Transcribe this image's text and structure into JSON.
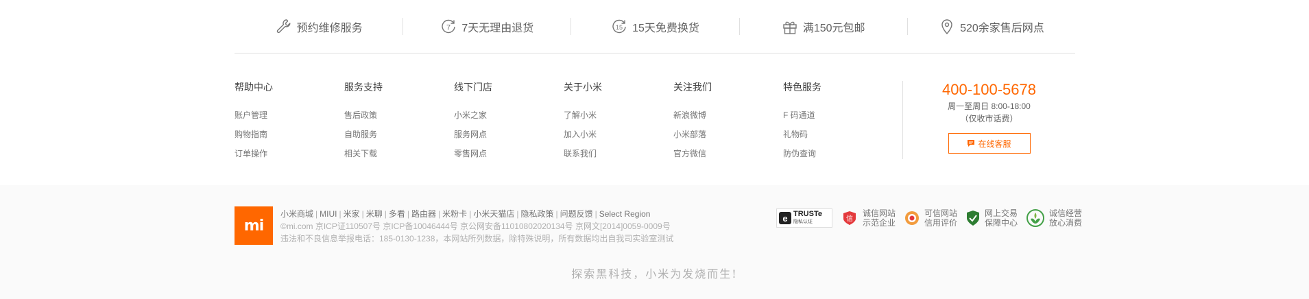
{
  "services": [
    {
      "icon": "wrench-icon",
      "label": "预约维修服务"
    },
    {
      "icon": "7-days-return-icon",
      "badge_num": "7",
      "label": "7天无理由退货"
    },
    {
      "icon": "15-days-exchange-icon",
      "badge_num": "15",
      "label": "15天免费换货"
    },
    {
      "icon": "gift-icon",
      "label": "满150元包邮"
    },
    {
      "icon": "location-pin-icon",
      "label": "520余家售后网点"
    }
  ],
  "columns": [
    {
      "title": "帮助中心",
      "links": [
        "账户管理",
        "购物指南",
        "订单操作"
      ]
    },
    {
      "title": "服务支持",
      "links": [
        "售后政策",
        "自助服务",
        "相关下载"
      ]
    },
    {
      "title": "线下门店",
      "links": [
        "小米之家",
        "服务网点",
        "零售网点"
      ]
    },
    {
      "title": "关于小米",
      "links": [
        "了解小米",
        "加入小米",
        "联系我们"
      ]
    },
    {
      "title": "关注我们",
      "links": [
        "新浪微博",
        "小米部落",
        "官方微信"
      ]
    },
    {
      "title": "特色服务",
      "links": [
        "F 码通道",
        "礼物码",
        "防伪查询"
      ]
    }
  ],
  "contact": {
    "phone": "400-100-5678",
    "hours": "周一至周日 8:00-18:00",
    "note": "（仅收市话费）",
    "cs_button": "在线客服"
  },
  "footer": {
    "logo_text": "mi",
    "site_links": [
      "小米商城",
      "MIUI",
      "米家",
      "米聊",
      "多看",
      "路由器",
      "米粉卡",
      "小米天猫店",
      "隐私政策",
      "问题反馈",
      "Select Region"
    ],
    "separator": "|",
    "icp_line": "©mi.com 京ICP证110507号 京ICP备10046444号 京公网安备11010802020134号 京网文[2014]0059-0009号",
    "report_line": "违法和不良信息举报电话：185-0130-1238，本网站所列数据，除特殊说明，所有数据均出自我司实验室测试",
    "badges": [
      {
        "icon": "truste-icon",
        "title": "TRUSTe",
        "sub": "隐私认证"
      },
      {
        "icon": "credit-seal-icon",
        "line1": "诚信网站",
        "line2": "示范企业"
      },
      {
        "icon": "trusted-site-icon",
        "line1": "可信网站",
        "line2": "信用评价"
      },
      {
        "icon": "online-trade-shield-icon",
        "line1": "网上交易",
        "line2": "保障中心"
      },
      {
        "icon": "integrity-business-icon",
        "line1": "诚信经营",
        "line2": "放心消费"
      }
    ],
    "slogan": "探索黑科技，小米为发烧而生!"
  },
  "colors": {
    "accent": "#ff6700",
    "footer_bg": "#fafafa"
  }
}
